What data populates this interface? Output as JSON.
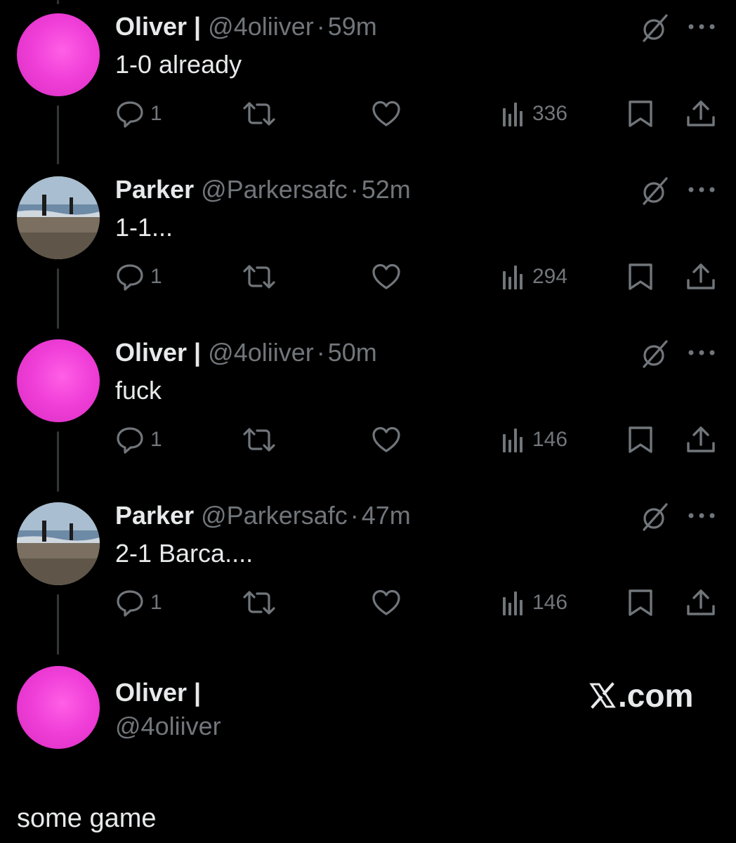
{
  "tweets": [
    {
      "name": "Oliver |",
      "handle": "@4oliiver",
      "time": "59m",
      "text": "1-0 already",
      "avatar": "pink-circle",
      "replies": "1",
      "views": "336"
    },
    {
      "name": "Parker",
      "handle": "@Parkersafc",
      "time": "52m",
      "text": "1-1...",
      "avatar": "beach-photo",
      "replies": "1",
      "views": "294"
    },
    {
      "name": "Oliver |",
      "handle": "@4oliiver",
      "time": "50m",
      "text": "fuck",
      "avatar": "pink-circle",
      "replies": "1",
      "views": "146"
    },
    {
      "name": "Parker",
      "handle": "@Parkersafc",
      "time": "47m",
      "text": "2-1 Barca....",
      "avatar": "beach-photo",
      "replies": "1",
      "views": "146"
    }
  ],
  "separator": "·",
  "final_post": {
    "name": "Oliver |",
    "handle": "@4oliiver",
    "text": "some game",
    "brand": ".com"
  },
  "icons": [
    "reply-icon",
    "retweet-icon",
    "like-icon",
    "views-icon",
    "bookmark-icon",
    "share-icon",
    "grok-icon",
    "more-icon",
    "x-logo-icon"
  ],
  "colors": {
    "background": "#000000",
    "primary_text": "#e7e9ea",
    "secondary_text": "#71767b",
    "thread_line": "#333639",
    "avatar_pink": "#f03fd8"
  }
}
